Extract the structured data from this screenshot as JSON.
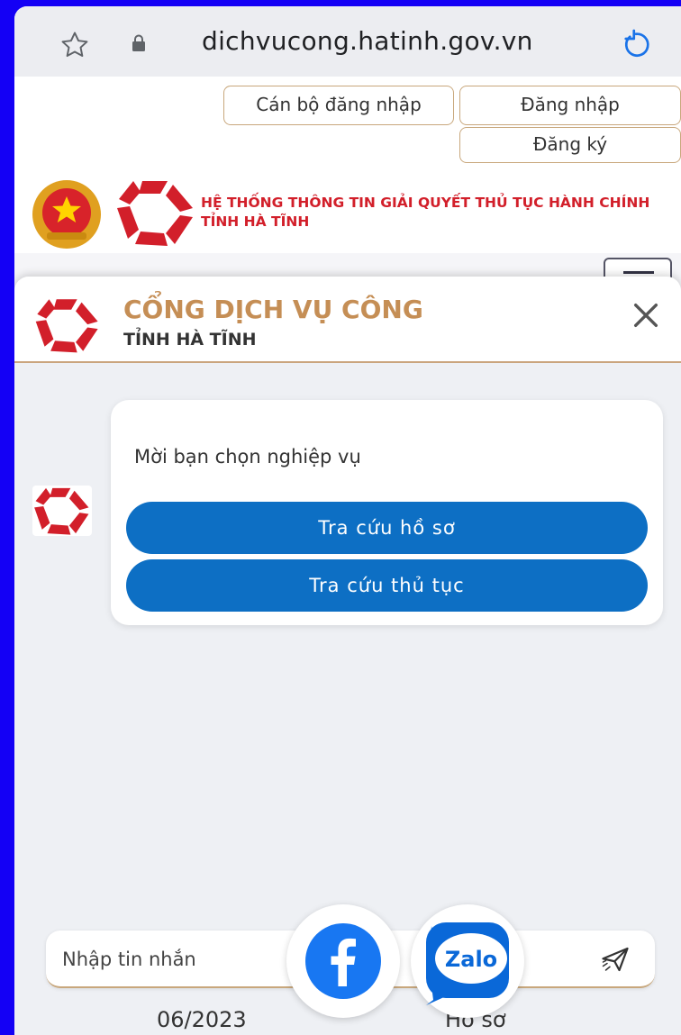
{
  "browser": {
    "url": "dichvucong.hatinh.gov.vn"
  },
  "header": {
    "staff_login_label": "Cán bộ đăng nhập",
    "login_label": "Đăng nhập",
    "register_label": "Đăng ký",
    "system_title_line1": "HỆ THỐNG THÔNG TIN GIẢI QUYẾT THỦ TỤC HÀNH CHÍNH",
    "system_title_line2": "TỈNH HÀ TĨNH"
  },
  "chat": {
    "title": "CỔNG DỊCH VỤ CÔNG",
    "subtitle": "TỈNH HÀ TĨNH",
    "bot_message": "Mời bạn chọn nghiệp vụ",
    "options": [
      {
        "label": "Tra cứu hồ sơ"
      },
      {
        "label": "Tra cứu thủ tục"
      }
    ],
    "input_placeholder": "Nhập tin nhắn"
  },
  "social": {
    "zalo_label": "Zalo"
  },
  "background_text": {
    "date": "06/2023",
    "label": "Hồ sơ"
  },
  "colors": {
    "frame": "#1400f5",
    "accent_blue": "#0d6fc4",
    "brand_red": "#d21f2a",
    "brand_gold": "#c58e55",
    "border_gold": "#c8a77c"
  },
  "icons": {
    "bookmark": "star-outline-icon",
    "secure": "lock-icon",
    "reload": "reload-icon",
    "close": "close-icon",
    "send": "send-icon",
    "menu": "hamburger-icon"
  }
}
